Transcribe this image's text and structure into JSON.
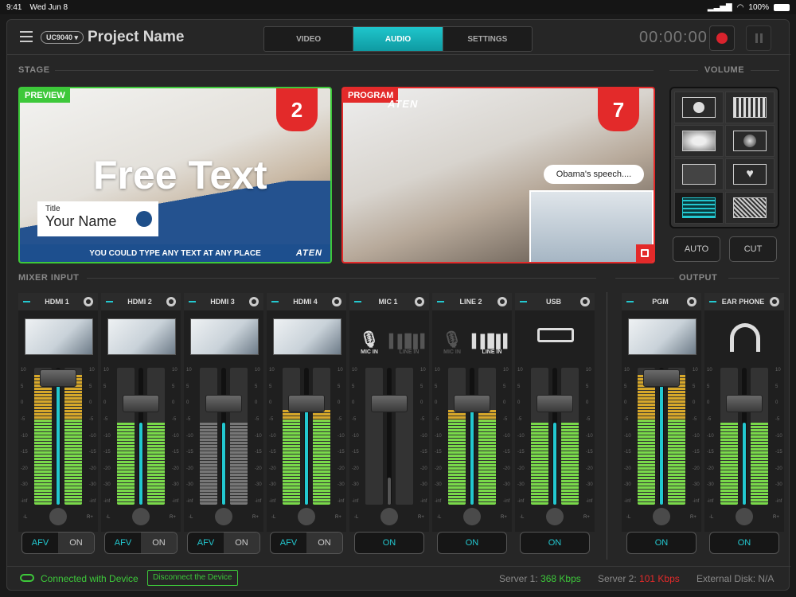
{
  "statusbar": {
    "time": "9:41",
    "date": "Wed Jun 8",
    "battery": "100%"
  },
  "header": {
    "model": "UC9040",
    "project_name": "Project Name",
    "tabs": [
      {
        "label": "VIDEO"
      },
      {
        "label": "AUDIO",
        "active": true
      },
      {
        "label": "SETTINGS"
      }
    ],
    "timer": "00:00:00"
  },
  "sections": {
    "stage": "STAGE",
    "volume": "VOLUME",
    "mixer_input": "MIXER  INPUT",
    "output": "OUTPUT"
  },
  "preview": {
    "tag": "PREVIEW",
    "number": "2",
    "free_text": "Free Text",
    "title_label": "Title",
    "name": "Your Name",
    "footer": "YOU COULD TYPE ANY TEXT AT ANY PLACE",
    "logo": "ATEN"
  },
  "program": {
    "tag": "PROGRAM",
    "number": "7",
    "bubble": "Obama's speech....",
    "logo": "ATEN"
  },
  "transitions": {
    "auto": "AUTO",
    "cut": "CUT"
  },
  "mixer_channels": [
    {
      "name": "HDMI 1",
      "level": 0.95,
      "afv": "AFV",
      "on": "ON"
    },
    {
      "name": "HDMI 2",
      "level": 0.6,
      "afv": "AFV",
      "on": "ON"
    },
    {
      "name": "HDMI 3",
      "level": 0.6,
      "afv": "AFV",
      "on": "ON"
    },
    {
      "name": "HDMI 4",
      "level": 0.7,
      "afv": "AFV",
      "on": "ON"
    },
    {
      "name": "MIC 1",
      "level": 0.0,
      "on": "ON",
      "mic_in": "MIC IN",
      "line_in": "LINE IN"
    },
    {
      "name": "LINE 2",
      "level": 0.7,
      "on": "ON",
      "mic_in": "MIC IN",
      "line_in": "LINE IN"
    },
    {
      "name": "USB",
      "level": 0.6,
      "on": "ON"
    }
  ],
  "output_channels": [
    {
      "name": "PGM",
      "level": 0.95,
      "on": "ON"
    },
    {
      "name": "EAR PHONE",
      "level": 0.6,
      "on": "ON"
    }
  ],
  "scale_labels": [
    "10",
    "5",
    "0",
    "-5",
    "-10",
    "-15",
    "-20",
    "-30",
    "-inf"
  ],
  "pan_labels": {
    "left": "-L",
    "right": "R+"
  },
  "footer": {
    "connected": "Connected with Device",
    "disconnect": "Disconnect the Device",
    "server1_label": "Server 1:",
    "server1_value": "368 Kbps",
    "server2_label": "Server 2:",
    "server2_value": "101 Kbps",
    "disk": "External Disk: N/A"
  },
  "colors": {
    "accent": "#23c8d0",
    "preview": "#3dc83a",
    "program": "#e32a2a",
    "meter_green": "#79d94a",
    "meter_yellow": "#d6a72a",
    "meter_gray": "#777777"
  }
}
